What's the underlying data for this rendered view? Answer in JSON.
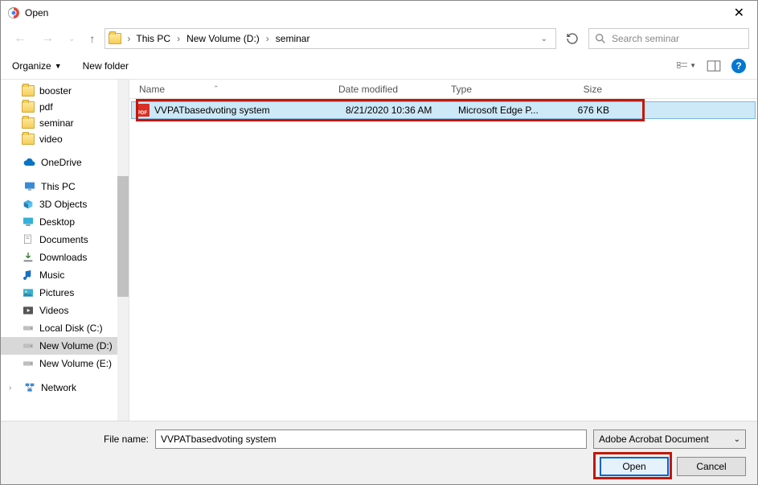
{
  "window": {
    "title": "Open"
  },
  "breadcrumb": {
    "items": [
      "This PC",
      "New Volume (D:)",
      "seminar"
    ]
  },
  "search": {
    "placeholder": "Search seminar"
  },
  "toolbar": {
    "organize": "Organize",
    "newfolder": "New folder"
  },
  "tree": {
    "folders_top": [
      "booster",
      "pdf",
      "seminar",
      "video"
    ],
    "onedrive": "OneDrive",
    "thispc": "This PC",
    "pc_items": [
      "3D Objects",
      "Desktop",
      "Documents",
      "Downloads",
      "Music",
      "Pictures",
      "Videos",
      "Local Disk (C:)",
      "New Volume (D:)",
      "New Volume (E:)"
    ],
    "network": "Network"
  },
  "columns": {
    "name": "Name",
    "date": "Date modified",
    "type": "Type",
    "size": "Size"
  },
  "files": [
    {
      "name": "VVPATbasedvoting system",
      "date": "8/21/2020 10:36 AM",
      "type": "Microsoft Edge P...",
      "size": "676 KB"
    }
  ],
  "footer": {
    "filename_label": "File name:",
    "filename_value": "VVPATbasedvoting system",
    "filetype": "Adobe Acrobat Document",
    "open": "Open",
    "cancel": "Cancel"
  }
}
